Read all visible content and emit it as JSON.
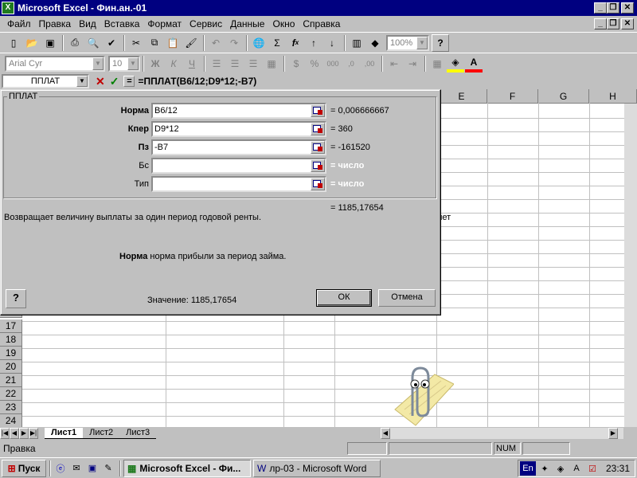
{
  "window": {
    "title": "Microsoft Excel - Фин.ан.-01",
    "app_icon": "excel-icon",
    "minimize": "_",
    "restore": "❐",
    "close": "✕"
  },
  "menu": [
    "Файл",
    "Правка",
    "Вид",
    "Вставка",
    "Формат",
    "Сервис",
    "Данные",
    "Окно",
    "Справка"
  ],
  "toolbar": {
    "zoom": "100%",
    "font_name": "Arial Cyr",
    "font_size": "10",
    "bold": "Ж",
    "italic": "К",
    "underline": "Ч",
    "sum": "Σ",
    "fx": "f",
    "fx_sub": "x",
    "percent": "%",
    "thousands": "000",
    "help": "?"
  },
  "formula_bar": {
    "name_box": "ППЛАТ",
    "cancel": "✕",
    "enter": "✓",
    "equals": "=",
    "formula": "=ППЛАТ(B6/12;D9*12;-B7)"
  },
  "grid": {
    "columns": [
      "E",
      "F",
      "G",
      "H"
    ],
    "rows": [
      "17",
      "18",
      "19",
      "20",
      "21",
      "22",
      "23",
      "24"
    ],
    "partial_row": "16",
    "partial_cell_text": "лет"
  },
  "dialog": {
    "group_title": "ППЛАТ",
    "args": [
      {
        "label": "Норма",
        "value": "B6/12",
        "result": "= 0,006666667",
        "bold": true
      },
      {
        "label": "Кпер",
        "value": "D9*12",
        "result": "= 360",
        "bold": true
      },
      {
        "label": "Пз",
        "value": "-B7",
        "result": "= -161520",
        "bold": true
      },
      {
        "label": "Бс",
        "value": "",
        "result": "= число",
        "bold": false
      },
      {
        "label": "Тип",
        "value": "",
        "result": "= число",
        "bold": false
      }
    ],
    "total_result": "= 1185,17654",
    "description": "Возвращает величину выплаты за один период годовой ренты.",
    "arg_help_name": "Норма",
    "arg_help_text": "норма прибыли за период займа.",
    "value_label": "Значение: 1185,17654",
    "ok_label": "ОК",
    "cancel_label": "Отмена",
    "help_label": "?"
  },
  "sheets": {
    "tabs": [
      "Лист1",
      "Лист2",
      "Лист3"
    ],
    "active": "Лист1"
  },
  "status_bar": {
    "text": "Правка",
    "num": "NUM"
  },
  "taskbar": {
    "start_label": "Пуск",
    "tasks": [
      {
        "label": "Microsoft Excel - Фи...",
        "active": true
      },
      {
        "label": "лр-03 - Microsoft Word",
        "active": false
      }
    ],
    "lang": "En",
    "clock": "23:31"
  }
}
